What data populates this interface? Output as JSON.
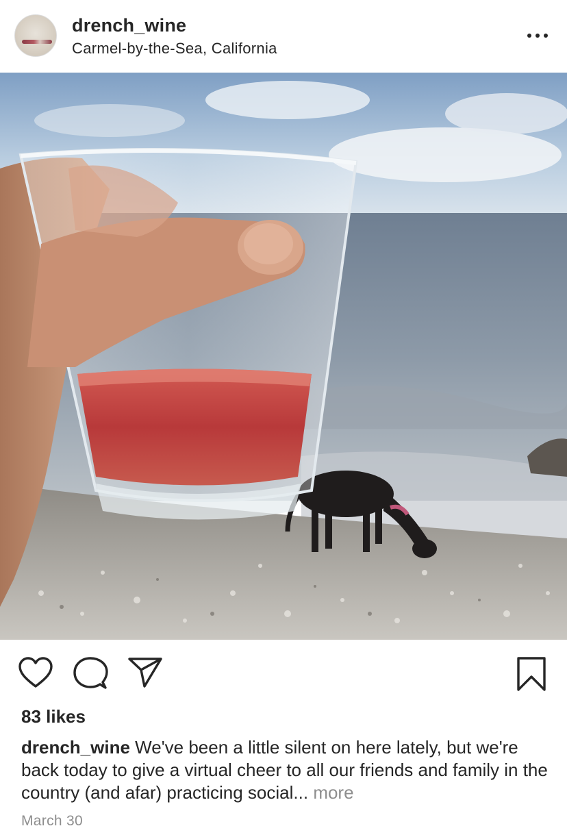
{
  "post": {
    "username": "drench_wine",
    "location": "Carmel-by-the-Sea, California",
    "likes": "83 likes",
    "caption_username": "drench_wine",
    "caption_text": " We've been a little silent on here lately, but we're back today to give a virtual cheer to all our friends and family in the country (and afar) practicing social...",
    "more_label": "more",
    "date": "March 30"
  },
  "icons": {
    "more": "more-options-icon",
    "like": "heart-icon",
    "comment": "comment-icon",
    "share": "paper-plane-icon",
    "save": "bookmark-icon"
  },
  "colors": {
    "text": "#262626",
    "secondary": "#8e8e8e",
    "background": "#ffffff",
    "wine": "#b8393a"
  }
}
